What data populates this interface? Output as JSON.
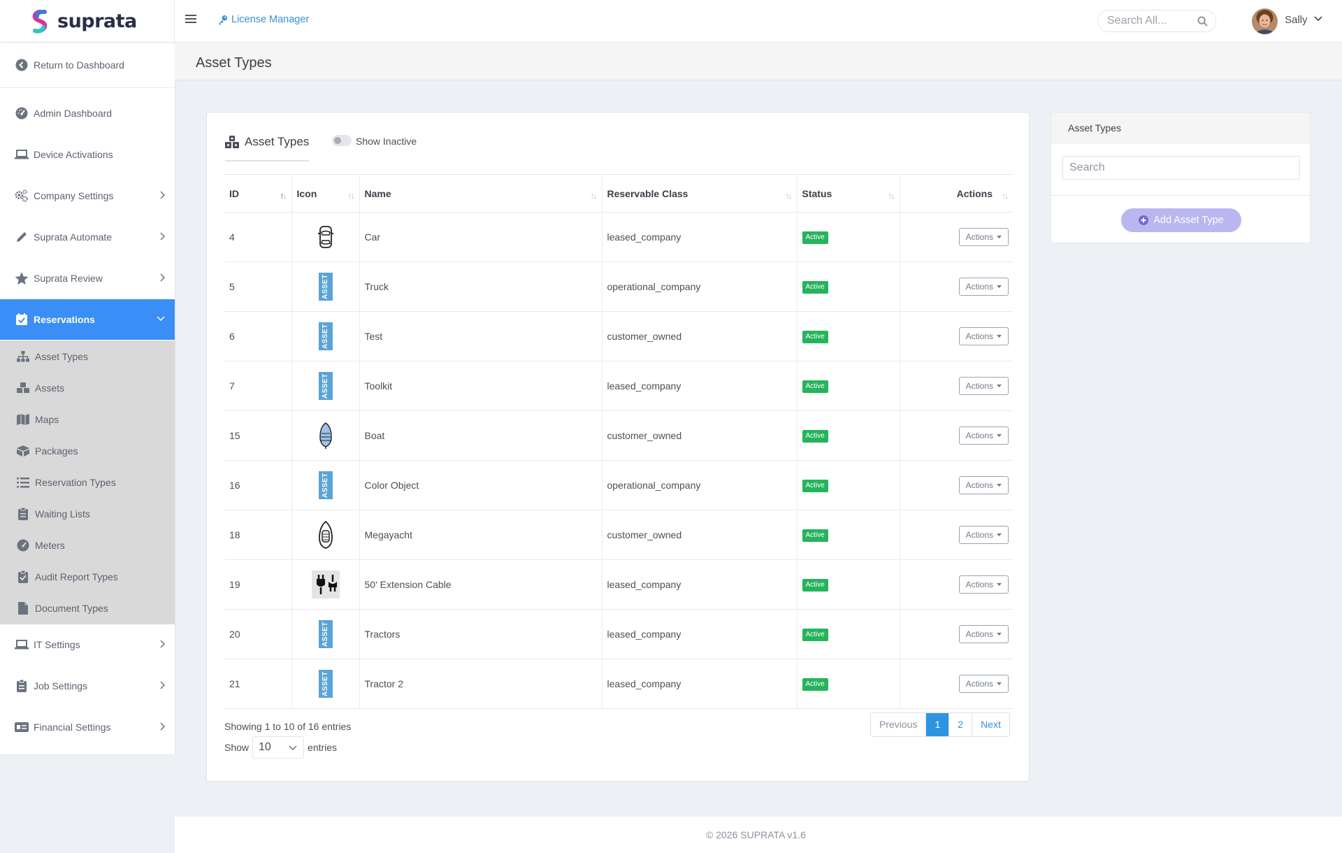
{
  "app": {
    "logo_text": "suprata",
    "breadcrumb": "License Manager",
    "search_placeholder": "Search All...",
    "user": "Sally"
  },
  "sidebar": {
    "top": [
      {
        "label": "Return to Dashboard",
        "icon": "back-circle-icon"
      },
      {
        "label": "Admin Dashboard",
        "icon": "gauge-icon"
      },
      {
        "label": "Device Activations",
        "icon": "laptop-icon"
      },
      {
        "label": "Company Settings",
        "icon": "gears-icon"
      },
      {
        "label": "Suprata Automate",
        "icon": "pen-icon"
      },
      {
        "label": "Suprata Review",
        "icon": "star-icon"
      },
      {
        "label": "Reservations",
        "icon": "calendar-check-icon"
      }
    ],
    "sub": [
      {
        "label": "Asset Types",
        "icon": "sitemap-icon"
      },
      {
        "label": "Assets",
        "icon": "cubes-icon"
      },
      {
        "label": "Maps",
        "icon": "map-icon"
      },
      {
        "label": "Packages",
        "icon": "box-icon"
      },
      {
        "label": "Reservation Types",
        "icon": "list-icon"
      },
      {
        "label": "Waiting Lists",
        "icon": "clipboard-list-icon"
      },
      {
        "label": "Meters",
        "icon": "meter-icon"
      },
      {
        "label": "Audit Report Types",
        "icon": "clipboard-check-icon"
      },
      {
        "label": "Document Types",
        "icon": "file-icon"
      }
    ],
    "bottom": [
      {
        "label": "IT Settings",
        "icon": "laptop-icon"
      },
      {
        "label": "Job Settings",
        "icon": "clipboard-icon"
      },
      {
        "label": "Financial Settings",
        "icon": "money-card-icon"
      }
    ]
  },
  "page": {
    "title": "Asset Types"
  },
  "card": {
    "tab": "Asset Types",
    "toggle_label": "Show Inactive"
  },
  "table": {
    "headers": [
      "ID",
      "Icon",
      "Name",
      "Reservable Class",
      "Status",
      "Actions"
    ],
    "rows": [
      {
        "id": "4",
        "icon": "car-icon",
        "name": "Car",
        "class": "leased_company",
        "status": "Active",
        "action": "Actions"
      },
      {
        "id": "5",
        "icon": "asset-tag-icon",
        "name": "Truck",
        "class": "operational_company",
        "status": "Active",
        "action": "Actions"
      },
      {
        "id": "6",
        "icon": "asset-tag-icon",
        "name": "Test",
        "class": "customer_owned",
        "status": "Active",
        "action": "Actions"
      },
      {
        "id": "7",
        "icon": "asset-tag-icon",
        "name": "Toolkit",
        "class": "leased_company",
        "status": "Active",
        "action": "Actions"
      },
      {
        "id": "15",
        "icon": "boat-icon",
        "name": "Boat",
        "class": "customer_owned",
        "status": "Active",
        "action": "Actions"
      },
      {
        "id": "16",
        "icon": "asset-tag-icon",
        "name": "Color Object",
        "class": "operational_company",
        "status": "Active",
        "action": "Actions"
      },
      {
        "id": "18",
        "icon": "yacht-icon",
        "name": "Megayacht",
        "class": "customer_owned",
        "status": "Active",
        "action": "Actions"
      },
      {
        "id": "19",
        "icon": "plug-icon",
        "name": "50' Extension Cable",
        "class": "leased_company",
        "status": "Active",
        "action": "Actions"
      },
      {
        "id": "20",
        "icon": "asset-tag-icon",
        "name": "Tractors",
        "class": "leased_company",
        "status": "Active",
        "action": "Actions"
      },
      {
        "id": "21",
        "icon": "asset-tag-icon",
        "name": "Tractor 2",
        "class": "leased_company",
        "status": "Active",
        "action": "Actions"
      }
    ],
    "asset_tag_text": "ASSET",
    "info": "Showing 1 to 10 of 16 entries",
    "show_label": "Show",
    "entries_label": "entries",
    "page_length": "10",
    "pagination": {
      "previous": "Previous",
      "pages": [
        "1",
        "2"
      ],
      "current": "1",
      "next": "Next"
    }
  },
  "panel": {
    "title": "Asset Types",
    "search_placeholder": "Search",
    "add_button": "Add Asset Type"
  },
  "footer": {
    "text": "© 2026 SUPRATA v1.6"
  },
  "colors": {
    "accent": "#3a8ef6",
    "link": "#3a8fd6",
    "active_badge": "#25b45c",
    "asset_tag": "#5aa3d6",
    "add_button": "#b9b7f0",
    "submenu_bg": "#d9d9d9"
  }
}
